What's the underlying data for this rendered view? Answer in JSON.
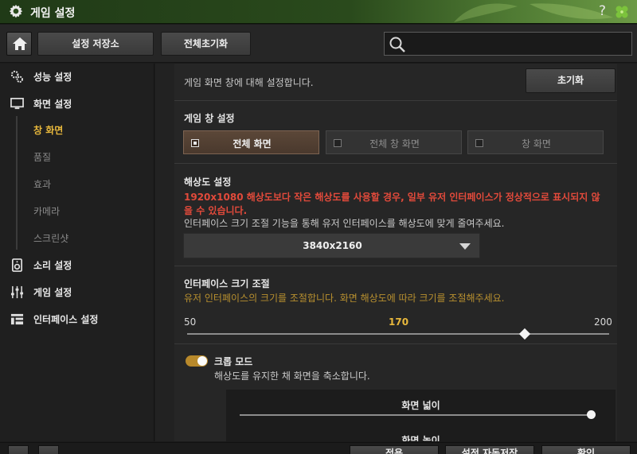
{
  "window": {
    "title": "게임 설정",
    "help_symbol": "?"
  },
  "toolbar": {
    "save_label": "설정 저장소",
    "reset_all_label": "전체초기화",
    "search_placeholder": ""
  },
  "sidebar": {
    "items": [
      {
        "label": "성능 설정",
        "icon": "gears-icon"
      },
      {
        "label": "화면 설정",
        "icon": "monitor-icon"
      },
      {
        "label": "소리 설정",
        "icon": "speaker-icon"
      },
      {
        "label": "게임 설정",
        "icon": "sliders-icon"
      },
      {
        "label": "인터페이스 설정",
        "icon": "layout-icon"
      }
    ],
    "subitems": [
      {
        "label": "창 화면",
        "active": true
      },
      {
        "label": "품질",
        "active": false
      },
      {
        "label": "효과",
        "active": false
      },
      {
        "label": "카메라",
        "active": false
      },
      {
        "label": "스크린샷",
        "active": false
      }
    ]
  },
  "main": {
    "intro": "게임 화면 창에 대해 설정합니다.",
    "reset_label": "초기화",
    "window_mode": {
      "heading": "게임 창 설정",
      "options": [
        {
          "label": "전체 화면",
          "selected": true
        },
        {
          "label": "전체 창 화면",
          "selected": false
        },
        {
          "label": "창 화면",
          "selected": false
        }
      ]
    },
    "resolution": {
      "heading": "해상도 설정",
      "warning_line1": "1920x1080 해상도보다 작은 해상도를 사용할 경우, 일부 유저 인터페이스가 정상적으로 표시되지 않",
      "warning_line2": "을 수 있습니다.",
      "info": "인터페이스 크기 조절 기능을 통해 유저 인터페이스를 해상도에 맞게 줄여주세요.",
      "selected": "3840x2160"
    },
    "ui_scale": {
      "heading": "인터페이스 크기 조절",
      "desc": "유저 인터페이스의 크기를 조절합니다. 화면 해상도에 따라 크기를 조절해주세요.",
      "min": "50",
      "value": "170",
      "max": "200",
      "fraction": 0.8
    },
    "crop_mode": {
      "label": "크롭 모드",
      "desc": "해상도를 유지한 채 화면을 축소합니다.",
      "enabled": true,
      "width_label": "화면 넓이",
      "width_fraction": 1.0,
      "height_label": "화면 높이"
    }
  },
  "footer": {
    "buttons": [
      "적용",
      "설정 자동저장",
      "확인"
    ]
  },
  "colors": {
    "accent": "#e8b83c",
    "warning": "#e24a3b",
    "toggle": "#b8892b"
  }
}
